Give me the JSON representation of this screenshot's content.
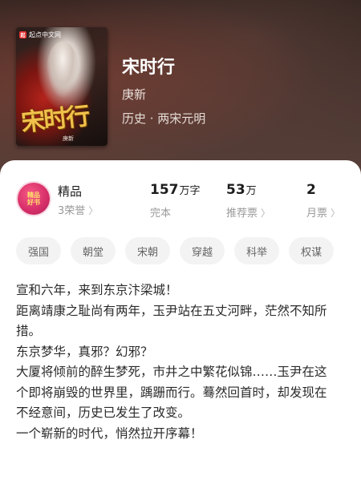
{
  "book": {
    "title": "宋时行",
    "author": "庚新",
    "category": "历史 · 两宋元明",
    "cover": {
      "platform_badge": "起点中文网",
      "title": "宋时行",
      "author": "庚新"
    }
  },
  "award": {
    "badge_line1": "精品",
    "badge_line2": "好书",
    "title": "精品",
    "honors": "3荣誉"
  },
  "stats": {
    "words": {
      "value": "157",
      "unit": "万字",
      "label": "完本"
    },
    "tickets": {
      "value": "53",
      "unit": "万",
      "label": "推荐票"
    },
    "monthly": {
      "value": "2",
      "label": "月票"
    }
  },
  "tags": [
    "强国",
    "朝堂",
    "宋朝",
    "穿越",
    "科举",
    "权谋"
  ],
  "description": [
    "宣和六年，来到东京汴梁城！",
    "距离靖康之耻尚有两年，玉尹站在五丈河畔，茫然不知所措。",
    "东京梦华，真邪？幻邪？",
    "大厦将倾前的醉生梦死，市井之中繁花似锦……玉尹在这个即将崩毁的世界里，踽跚而行。蓦然回首时，却发现在不经意间，历史已发生了改变。",
    "一个崭新的时代，悄然拉开序幕！"
  ],
  "icons": {
    "chevron": "chevron-right-icon"
  },
  "colors": {
    "accent_gold": "#f1c14b",
    "badge_pink": "#d8306a"
  }
}
